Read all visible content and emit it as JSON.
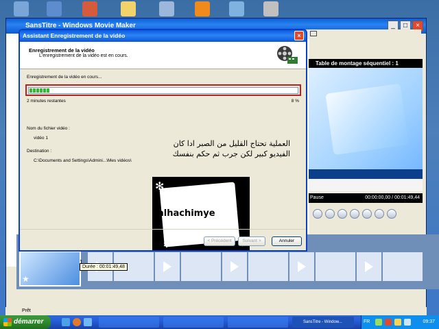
{
  "dialog": {
    "title": "Assistant Enregistrement de la vidéo",
    "header_title": "Enregistrement de la vidéo",
    "header_subtitle": "L'enregistrement de la vidéo est en cours.",
    "progress_label": "Enregistrement de la vidéo en cours...",
    "progress_percent": 8,
    "progress_percent_text": "8 %",
    "time_remaining": "2 minutes restantes",
    "filename_label": "Nom du fichier vidéo :",
    "filename_value": "vidéo 1",
    "destination_label": "Destination :",
    "destination_value": "C:\\Documents and Settings\\Admini...\\Mes vidéos\\",
    "buttons": {
      "previous": "< Précédent",
      "next": "Suivant >",
      "cancel": "Annuler"
    }
  },
  "overlay": {
    "arabic_line1": "العملية تحتاج القليل من الصبر ادا كان",
    "arabic_line2": "الفيديو كبير لكن جرب ثم حكم بنفسك",
    "signature": "alhachimye"
  },
  "movie_maker": {
    "window_title": "SansTitre - Windows Movie Maker",
    "preview_title": "Table de montage séquentiel : 1",
    "preview_status": "Pause",
    "timecode": "00:00:00,00 / 00:01:49,44",
    "clip_number": "1",
    "clip_tooltip": "Durée : 00:01:49,48",
    "statusbar": "Prêt"
  },
  "taskbar": {
    "start_label": "démarrer",
    "active_task": "SansTitre - Window...",
    "language": "FR",
    "clock": "09:37"
  },
  "colors": {
    "xp_blue": "#0a5fd8",
    "start_green": "#2f8a2f",
    "progress_green": "#2fbd2f",
    "highlight_red": "#b42424"
  }
}
